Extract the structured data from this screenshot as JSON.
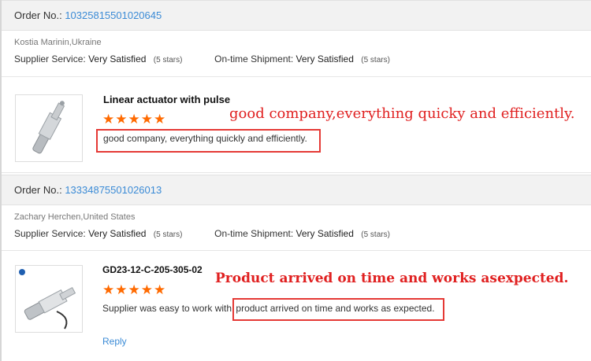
{
  "orders": [
    {
      "order_label": "Order No.:",
      "order_number": "10325815501020645",
      "buyer": "Kostia Marinin,Ukraine",
      "supplier_service_label": "Supplier Service:",
      "supplier_service_value": "Very Satisfied",
      "supplier_service_stars": "(5 stars)",
      "shipment_label": "On-time Shipment:",
      "shipment_value": "Very Satisfied",
      "shipment_stars": "(5 stars)",
      "product_title": "Linear actuator with pulse",
      "rating_stars": "★★★★★",
      "review_text": "good company, everything quickly and efficiently.",
      "annotation": "good company,everything quicky and efficiently."
    },
    {
      "order_label": "Order No.:",
      "order_number": "13334875501026013",
      "buyer": "Zachary Herchen,United States",
      "supplier_service_label": "Supplier Service:",
      "supplier_service_value": "Very Satisfied",
      "supplier_service_stars": "(5 stars)",
      "shipment_label": "On-time Shipment:",
      "shipment_value": "Very Satisfied",
      "shipment_stars": "(5 stars)",
      "product_title": "GD23-12-C-205-305-02",
      "rating_stars": "★★★★★",
      "review_prefix": "Supplier was easy to work with,",
      "review_text": "product arrived on time and works as expected.",
      "annotation": "Product arrived on time and works asexpected.",
      "reply_label": "Reply"
    }
  ]
}
